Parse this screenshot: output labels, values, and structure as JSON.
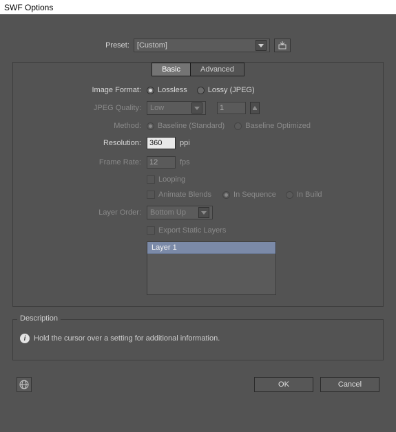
{
  "window": {
    "title": "SWF Options"
  },
  "preset": {
    "label": "Preset:",
    "value": "[Custom]"
  },
  "tabs": {
    "basic": "Basic",
    "advanced": "Advanced"
  },
  "imageFormat": {
    "label": "Image Format:",
    "lossless": "Lossless",
    "lossy": "Lossy (JPEG)"
  },
  "jpegQuality": {
    "label": "JPEG Quality:",
    "preset": "Low",
    "value": "1"
  },
  "method": {
    "label": "Method:",
    "baselineStd": "Baseline (Standard)",
    "baselineOpt": "Baseline Optimized"
  },
  "resolution": {
    "label": "Resolution:",
    "value": "360",
    "unit": "ppi"
  },
  "frameRate": {
    "label": "Frame Rate:",
    "value": "12",
    "unit": "fps"
  },
  "looping": {
    "label": "Looping"
  },
  "animateBlends": {
    "label": "Animate Blends",
    "inSequence": "In Sequence",
    "inBuild": "In Build"
  },
  "layerOrder": {
    "label": "Layer Order:",
    "value": "Bottom Up"
  },
  "exportStatic": {
    "label": "Export Static Layers"
  },
  "layers": {
    "items": [
      "Layer 1"
    ]
  },
  "description": {
    "title": "Description",
    "text": "Hold the cursor over a setting for additional information."
  },
  "buttons": {
    "ok": "OK",
    "cancel": "Cancel"
  }
}
